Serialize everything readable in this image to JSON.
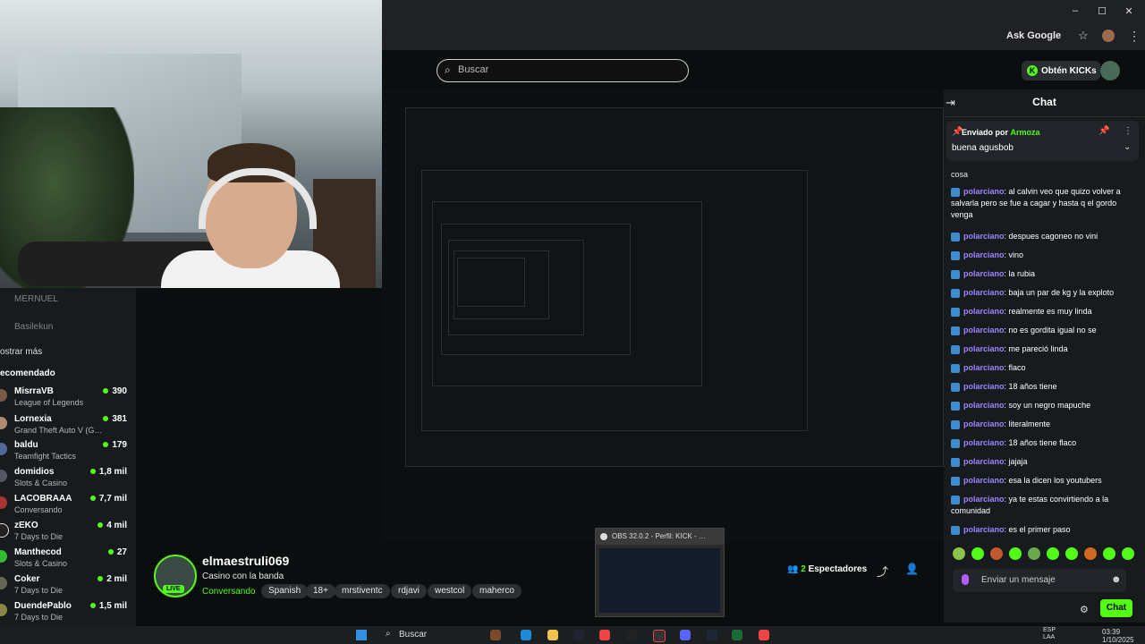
{
  "browser": {
    "window_min": "–",
    "window_max": "☐",
    "window_close": "✕",
    "ask_google": "Ask Google",
    "star_icon": "☆",
    "menu_icon": "⋮"
  },
  "kick": {
    "search_placeholder": "Buscar",
    "get_kicks_label": "Obtén KICKs",
    "kick_icon": "K"
  },
  "sidebar": {
    "faded_items": [
      "MERNUEL",
      "Basilekun"
    ],
    "show_more": "ostrar más",
    "recommended_header": "ecomendado",
    "items": [
      {
        "name": "MisrraVB",
        "category": "League of Legends",
        "viewers": "390",
        "avatar_color": "#7a5a45"
      },
      {
        "name": "Lornexia",
        "category": "Grand Theft Auto V (G…",
        "viewers": "381",
        "avatar_color": "#b08a70"
      },
      {
        "name": "baldu",
        "category": "Teamfight Tactics",
        "viewers": "179",
        "avatar_color": "#4f6a9a"
      },
      {
        "name": "domidios",
        "category": "Slots & Casino",
        "viewers": "1,8 mil",
        "avatar_color": "#556"
      },
      {
        "name": "LACOBRAAA",
        "category": "Conversando",
        "viewers": "7,7 mil",
        "avatar_color": "#a33"
      },
      {
        "name": "zEKO",
        "category": "7 Days to Die",
        "viewers": "4 mil",
        "avatar_color": "#222"
      },
      {
        "name": "Manthecod",
        "category": "Slots & Casino",
        "viewers": "27",
        "avatar_color": "#3b3"
      },
      {
        "name": "Coker",
        "category": "7 Days to Die",
        "viewers": "2 mil",
        "avatar_color": "#665"
      },
      {
        "name": "DuendePablo",
        "category": "7 Days to Die",
        "viewers": "1,5 mil",
        "avatar_color": "#884"
      }
    ]
  },
  "stream": {
    "streamer": "elmaestruli069",
    "title": "Casino con la banda",
    "category": "Conversando",
    "live": "LIVE",
    "tags": [
      "Spanish",
      "18+",
      "mrstiventc",
      "rdjavi",
      "westcol",
      "maherco"
    ],
    "viewers_count": "2",
    "viewers_label": "Espectadores"
  },
  "obs": {
    "title": "OBS 32.0.2 - Perfil: KICK - …"
  },
  "chat": {
    "title": "Chat",
    "pinned_by_label": "Enviado por",
    "pinned_by_user": "Armoza",
    "pinned_message": "buena agusbob",
    "first_line": "cosa",
    "messages": [
      {
        "user": "polarciano",
        "text": "al calvin veo que quizo volver a salvarla pero se fue a cagar y hasta q el gordo venga"
      },
      {
        "user": "polarciano",
        "text": "despues cagoneo no vini"
      },
      {
        "user": "polarciano",
        "text": "vino"
      },
      {
        "user": "polarciano",
        "text": "la rubia"
      },
      {
        "user": "polarciano",
        "text": "baja un par de kg y la exploto"
      },
      {
        "user": "polarciano",
        "text": "realmente es muy linda"
      },
      {
        "user": "polarciano",
        "text": "no es gordita igual no se"
      },
      {
        "user": "polarciano",
        "text": "me pareció linda"
      },
      {
        "user": "polarciano",
        "text": "flaco"
      },
      {
        "user": "polarciano",
        "text": "18 años tiene"
      },
      {
        "user": "polarciano",
        "text": "soy un negro mapuche"
      },
      {
        "user": "polarciano",
        "text": "literalmente"
      },
      {
        "user": "polarciano",
        "text": "18 años tiene flaco"
      },
      {
        "user": "polarciano",
        "text": "jajaja"
      },
      {
        "user": "polarciano",
        "text": "esa la dicen los youtubers"
      },
      {
        "user": "polarciano",
        "text": "ya te estas convirtiendo a la comunidad"
      },
      {
        "user": "polarciano",
        "text": "es el primer paso"
      }
    ],
    "input_placeholder": "Enviar un mensaje",
    "send_label": "Chat"
  },
  "taskbar": {
    "search_label": "Buscar",
    "lang": "ESP",
    "lang2": "LAA",
    "time": "03:39",
    "date": "1/10/2025"
  },
  "colors": {
    "accent": "#53fc18",
    "username": "#9c84ff",
    "background": "#0b0e0f",
    "panel": "#181b1d"
  }
}
